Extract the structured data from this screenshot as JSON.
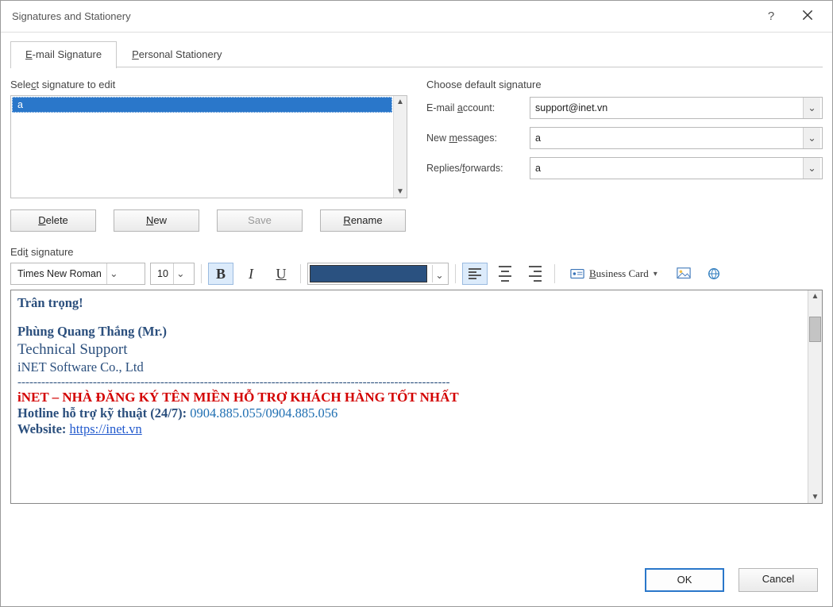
{
  "window": {
    "title": "Signatures and Stationery"
  },
  "tabs": {
    "email_sig": "E-mail Signature",
    "personal_stationery": "Personal Stationery"
  },
  "select_label": "Select signature to edit",
  "signature_list": [
    "a"
  ],
  "buttons": {
    "delete": "Delete",
    "new": "New",
    "save": "Save",
    "rename": "Rename"
  },
  "default_sig": {
    "heading": "Choose default signature",
    "account_label": "E-mail account:",
    "account_value": "support@inet.vn",
    "new_msg_label": "New messages:",
    "new_msg_value": "a",
    "replies_label": "Replies/forwards:",
    "replies_value": "a"
  },
  "edit_label": "Edit signature",
  "toolbar": {
    "font": "Times New Roman",
    "size": "10",
    "color": "#2a5180",
    "business_card": "Business Card"
  },
  "signature_body": {
    "greeting": "Trân trọng!",
    "name": "Phùng Quang Thắng (Mr.)",
    "role": "Technical Support",
    "company": "iNET Software Co., Ltd",
    "dashline": "-------------------------------------------------------------------------------------------------------------",
    "slogan": "iNET – NHÀ ĐĂNG KÝ TÊN MIỀN HỖ TRỢ KHÁCH HÀNG TỐT NHẤT",
    "hotline_label": "Hotline hỗ trợ kỹ thuật (24/7): ",
    "hotline_value": "0904.885.055/0904.885.056",
    "website_label": "Website: ",
    "website_link": "https://inet.vn"
  },
  "footer": {
    "ok": "OK",
    "cancel": "Cancel"
  }
}
